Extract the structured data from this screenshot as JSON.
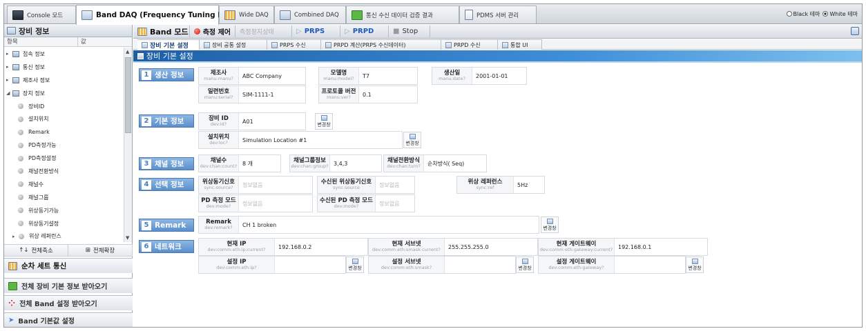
{
  "tabs": [
    "Console 모드",
    "Band DAQ (Frequency Tuning DAQ)",
    "Wide DAQ",
    "Combined DAQ",
    "통신 수신 데이터 검증 결과",
    "PDMS 서버 관리"
  ],
  "theme": {
    "black": "Black 테마",
    "white": "White 테마"
  },
  "sidebar": {
    "title": "장비 정보",
    "col_item": "항목",
    "col_value": "값",
    "tree": [
      "접속 정보",
      "통신 정보",
      "제조사 정보",
      "장치 정보",
      "장비ID",
      "설치위치",
      "Remark",
      "PD측정가능",
      "PD측정설정",
      "채널전환방식",
      "채널수",
      "채널그룹",
      "위상동기가능",
      "위상동기설정",
      "위상 레퍼런스"
    ],
    "collapse_all": "전체축소",
    "expand_all": "전체확장",
    "seq_comm": "순차 세트 통신",
    "get_all_info": "전체 장비 기본 정보 받아오기",
    "get_all_band": "전체 Band 설정 받아오기",
    "band_default": "Band 기본값 설정"
  },
  "toolbar": {
    "title": "Band 모드",
    "measure": "측정 제어",
    "status": "측정정지상태",
    "prps": "PRPS",
    "prpd": "PRPD",
    "stop": "Stop"
  },
  "subtabs": [
    "장비 기본 설정",
    "장비 공통 설정",
    "PRPS 수신",
    "PRPD 계산(PRPS 수신데이터)",
    "PRPD 수신",
    "통합 UI"
  ],
  "banner": "장비 기본 설정",
  "sections": [
    "생산 정보",
    "기본 정보",
    "채널 정보",
    "선택 정보",
    "Remark",
    "네트워크"
  ],
  "fields": {
    "maker": {
      "label": "제조사",
      "key": "manu:manu?",
      "value": "ABC Company"
    },
    "model": {
      "label": "모델명",
      "key": "manu:model?",
      "value": "T7"
    },
    "date": {
      "label": "생산일",
      "key": "manu:date?",
      "value": "2001-01-01"
    },
    "serial": {
      "label": "일련번호",
      "key": "manu:serial?",
      "value": "SIM-1111-1"
    },
    "protocol": {
      "label": "프로토콜 버전",
      "key": "manu:ver?",
      "value": "0.1"
    },
    "devid": {
      "label": "장비 ID",
      "key": "dev:id?",
      "value": "A01"
    },
    "loc": {
      "label": "설치위치",
      "key": "dev:loc?",
      "value": "Simulation Location #1"
    },
    "chcount": {
      "label": "채널수",
      "key": "dev:chan:count?",
      "value": "8 개"
    },
    "chgroup": {
      "label": "채널그룹정보",
      "key": "dev:chan:group?",
      "value": "3,4,3"
    },
    "chturn": {
      "label": "채널전환방식",
      "key": "dev:chan:turn?",
      "value": "순차방식( Seq)"
    },
    "syncsrc": {
      "label": "위상동기신호",
      "key": "sync:source?",
      "value": "정보없음"
    },
    "rsyncsrc": {
      "label": "수신된 위상동기신호",
      "key": "sync:source",
      "value": "정보없음"
    },
    "syncref": {
      "label": "위상 레퍼런스",
      "key": "sync:ref",
      "value": "5Hz"
    },
    "pdmode": {
      "label": "PD 측정 모드",
      "key": "dev:mode?",
      "value": "정보없음"
    },
    "rpdmode": {
      "label": "수신된 PD 측정 모드",
      "key": "dev:mode?",
      "value": "정보없음"
    },
    "remark": {
      "label": "Remark",
      "key": "dev:remark?",
      "value": "CH 1 broken"
    },
    "curip": {
      "label": "현재 IP",
      "key": "dev:comm:eth:ip:current?",
      "value": "192.168.0.2"
    },
    "cursub": {
      "label": "현재 서브넷",
      "key": "dev:comm:eth:smask:current?",
      "value": "255.255.255.0"
    },
    "curgw": {
      "label": "현재 게이트웨이",
      "key": "dev:comm:eth:gateway:current?",
      "value": "192.168.0.1"
    },
    "setip": {
      "label": "설정 IP",
      "key": "dev:comm:eth:ip?",
      "value": ""
    },
    "setsub": {
      "label": "설정 서브넷",
      "key": "dev:comm:eth:smask?",
      "value": ""
    },
    "setgw": {
      "label": "설정 게이트웨이",
      "key": "dev:comm:eth:gateway?",
      "value": ""
    }
  },
  "change_label": "변경창"
}
